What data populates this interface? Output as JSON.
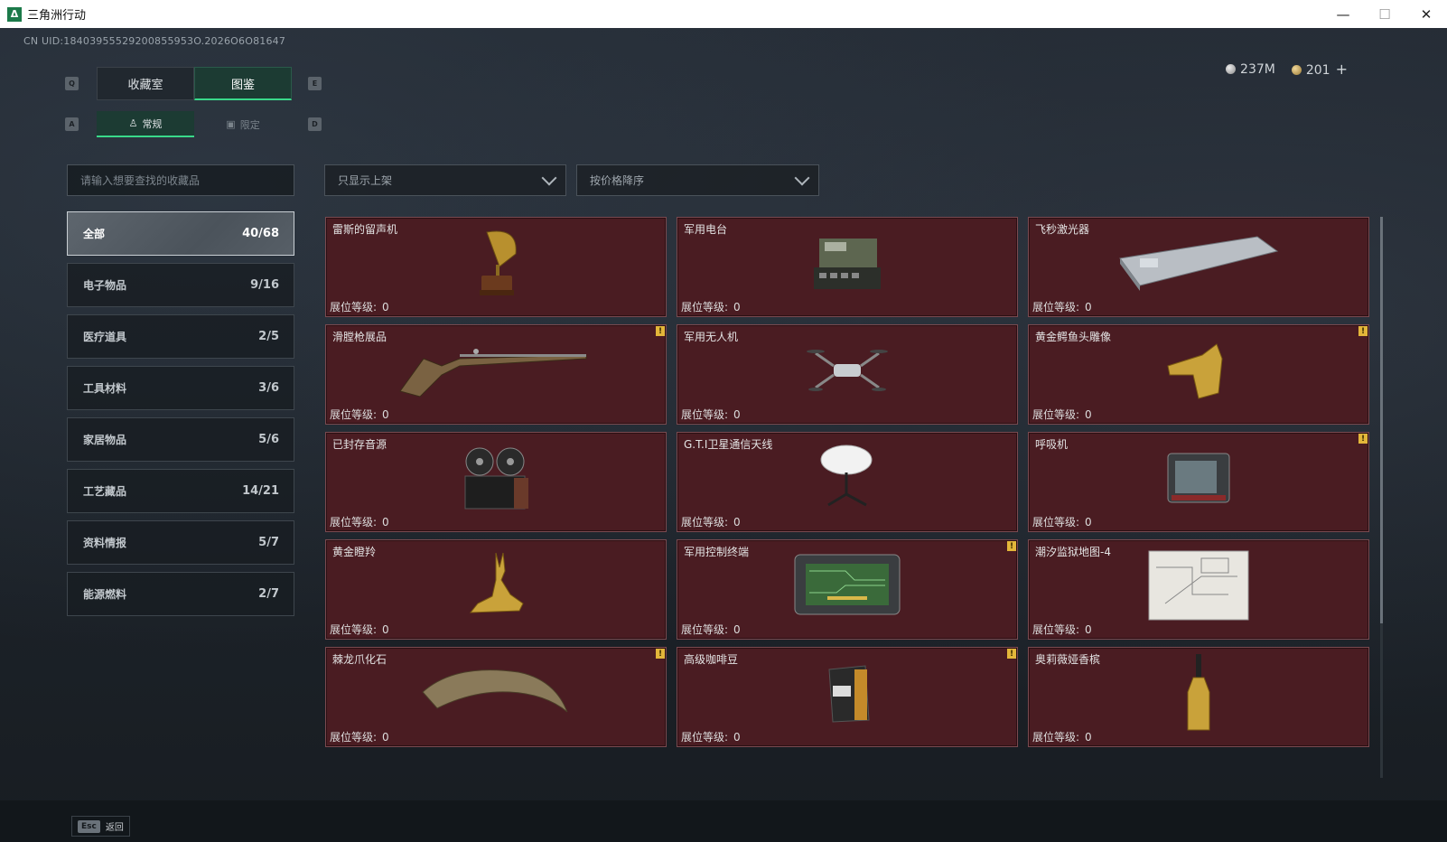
{
  "window": {
    "title": "三角洲行动",
    "logo_glyph": "Δ",
    "minimize": "—",
    "maximize": "☐",
    "close": "✕"
  },
  "header": {
    "uid_text": "CN UID:18403955529200855953O.2026O6O81647",
    "currency_silver": "237M",
    "currency_gold": "201",
    "add_label": "+"
  },
  "tabs": {
    "key_left": "Q",
    "key_right": "E",
    "items": [
      {
        "label": "收藏室",
        "active": false
      },
      {
        "label": "图鉴",
        "active": true
      }
    ]
  },
  "subtabs": {
    "key_left": "A",
    "key_right": "D",
    "items": [
      {
        "label": "常规",
        "icon": "figure-icon",
        "active": true
      },
      {
        "label": "限定",
        "icon": "image-icon",
        "active": false
      }
    ]
  },
  "search": {
    "placeholder": "请输入想要查找的收藏品"
  },
  "filters": {
    "shelf": "只显示上架",
    "sort": "按价格降序"
  },
  "categories": [
    {
      "label": "全部",
      "count": "40/68",
      "active": true
    },
    {
      "label": "电子物品",
      "count": "9/16"
    },
    {
      "label": "医疗道具",
      "count": "2/5"
    },
    {
      "label": "工具材料",
      "count": "3/6"
    },
    {
      "label": "家居物品",
      "count": "5/6"
    },
    {
      "label": "工艺藏品",
      "count": "14/21"
    },
    {
      "label": "资料情报",
      "count": "5/7"
    },
    {
      "label": "能源燃料",
      "count": "2/7"
    }
  ],
  "level_label": "展位等级:",
  "items": [
    {
      "name": "雷斯的留声机",
      "level": "0",
      "warn": false,
      "icon": "gramophone-icon"
    },
    {
      "name": "军用电台",
      "level": "0",
      "warn": false,
      "icon": "radio-icon"
    },
    {
      "name": "飞秒激光器",
      "level": "0",
      "warn": false,
      "icon": "laser-device-icon"
    },
    {
      "name": "滑膛枪展品",
      "level": "0",
      "warn": true,
      "icon": "musket-icon"
    },
    {
      "name": "军用无人机",
      "level": "0",
      "warn": false,
      "icon": "drone-icon"
    },
    {
      "name": "黄金鳄鱼头雕像",
      "level": "0",
      "warn": true,
      "icon": "gold-crocodile-icon"
    },
    {
      "name": "已封存音源",
      "level": "0",
      "warn": false,
      "icon": "reel-recorder-icon"
    },
    {
      "name": "G.T.I卫星通信天线",
      "level": "0",
      "warn": false,
      "icon": "satellite-dish-icon"
    },
    {
      "name": "呼吸机",
      "level": "0",
      "warn": true,
      "icon": "ventilator-icon"
    },
    {
      "name": "黄金瞪羚",
      "level": "0",
      "warn": false,
      "icon": "gold-gazelle-icon"
    },
    {
      "name": "军用控制终端",
      "level": "0",
      "warn": true,
      "icon": "control-terminal-icon"
    },
    {
      "name": "潮汐监狱地图-4",
      "level": "0",
      "warn": false,
      "icon": "map-icon"
    },
    {
      "name": "棘龙爪化石",
      "level": "0",
      "warn": true,
      "icon": "claw-fossil-icon"
    },
    {
      "name": "高级咖啡豆",
      "level": "0",
      "warn": true,
      "icon": "coffee-bag-icon"
    },
    {
      "name": "奥莉薇娅香槟",
      "level": "0",
      "warn": false,
      "icon": "champagne-icon"
    }
  ],
  "warn_glyph": "!",
  "footer": {
    "esc_key": "Esc",
    "back_label": "返回"
  }
}
